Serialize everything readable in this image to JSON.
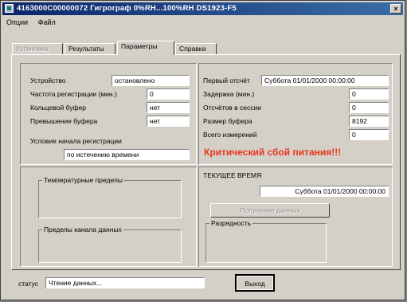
{
  "window": {
    "title": "4163000C00000072  Гигрограф 0%RH...100%RH   DS1923-F5",
    "close_glyph": "×"
  },
  "menu": [
    "Опции",
    "Файл"
  ],
  "tabs": [
    {
      "label": "Установка",
      "state": "disabled"
    },
    {
      "label": "Результаты",
      "state": "normal"
    },
    {
      "label": "Параметры",
      "state": "active"
    },
    {
      "label": "Справка",
      "state": "normal"
    }
  ],
  "device": {
    "rows": [
      {
        "label": "Устройство",
        "value": "остановлено"
      },
      {
        "label": "Частота регистрации (мин.)",
        "value": "0"
      },
      {
        "label": "Кольцевой буфер",
        "value": "нет"
      },
      {
        "label": "Превышение буфера",
        "value": "нет"
      }
    ],
    "start_condition_label": "Условие начала регистрации",
    "start_condition_value": "по истечению времени"
  },
  "session": {
    "rows": [
      {
        "label": "Первый отсчёт",
        "value": "Суббота 01/01/2000 00:00:00"
      },
      {
        "label": "Задержка (мин.)",
        "value": "0"
      },
      {
        "label": "Отсчётов в сессии",
        "value": "0"
      },
      {
        "label": "Размер буфера",
        "value": "8192"
      },
      {
        "label": "Всего измерений",
        "value": "0"
      }
    ],
    "alert": "Критический сбой питания!!!"
  },
  "limits": {
    "temperature_label": "Температурные пределы",
    "channel_label": "Пределы канала данных"
  },
  "current_time": {
    "label": "ТЕКУЩЕЕ ВРЕМЯ",
    "value": "Суббота 01/01/2000 00:00:00",
    "button": "Получение данных",
    "resolution_label": "Разрядность"
  },
  "status": {
    "label": "статус",
    "value": "Чтение данных..."
  },
  "exit_button": "Выход",
  "colors": {
    "title_bar": "#0a246a",
    "face": "#d4d0c8",
    "alert": "#e8351e"
  }
}
